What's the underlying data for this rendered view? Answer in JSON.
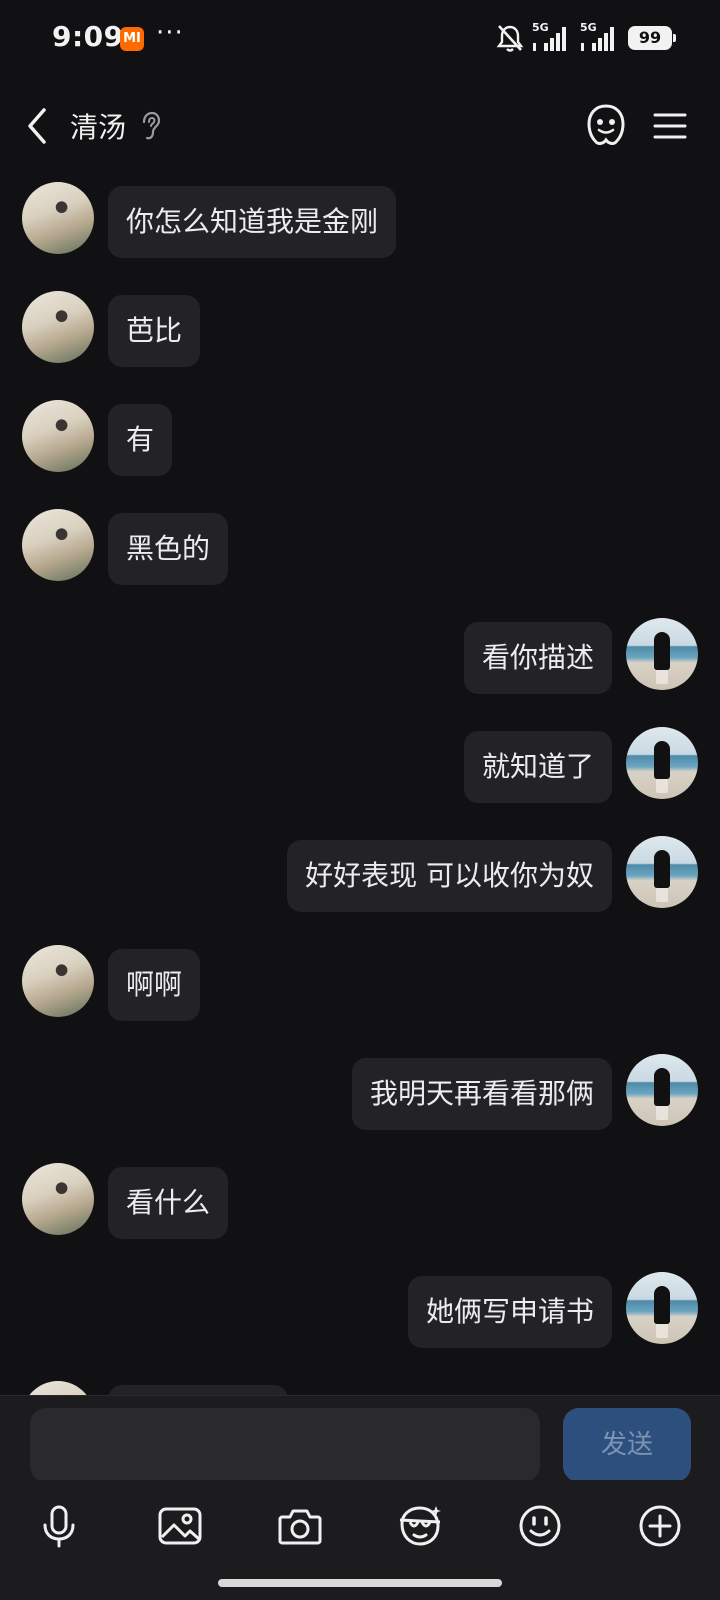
{
  "status_bar": {
    "time": "9:09",
    "app_badge": "MI",
    "more": "···",
    "signal_1": "5G",
    "signal_2": "5G",
    "battery": "99"
  },
  "header": {
    "title": "清汤",
    "icons": [
      "back-icon",
      "ear-icon",
      "bot-icon",
      "menu-icon"
    ]
  },
  "messages": [
    {
      "side": "left",
      "text": "你怎么知道我是金刚"
    },
    {
      "side": "left",
      "text": "芭比"
    },
    {
      "side": "left",
      "text": "有"
    },
    {
      "side": "left",
      "text": "黑色的"
    },
    {
      "side": "right",
      "text": "看你描述"
    },
    {
      "side": "right",
      "text": "就知道了"
    },
    {
      "side": "right",
      "text": "好好表现 可以收你为奴"
    },
    {
      "side": "left",
      "text": "啊啊"
    },
    {
      "side": "right",
      "text": "我明天再看看那俩"
    },
    {
      "side": "left",
      "text": "看什么"
    },
    {
      "side": "right",
      "text": "她俩写申请书"
    },
    {
      "side": "left",
      "text": ""
    }
  ],
  "composer": {
    "placeholder": "",
    "send_label": "发送"
  },
  "toolbar": {
    "icons": [
      "microphone-icon",
      "image-icon",
      "camera-icon",
      "face-sticker-icon",
      "emoji-icon",
      "plus-icon"
    ]
  },
  "colors": {
    "background": "#111113",
    "bubble": "#232327",
    "send_button": "#2d4f7d",
    "mi_badge": "#ff6a00"
  }
}
